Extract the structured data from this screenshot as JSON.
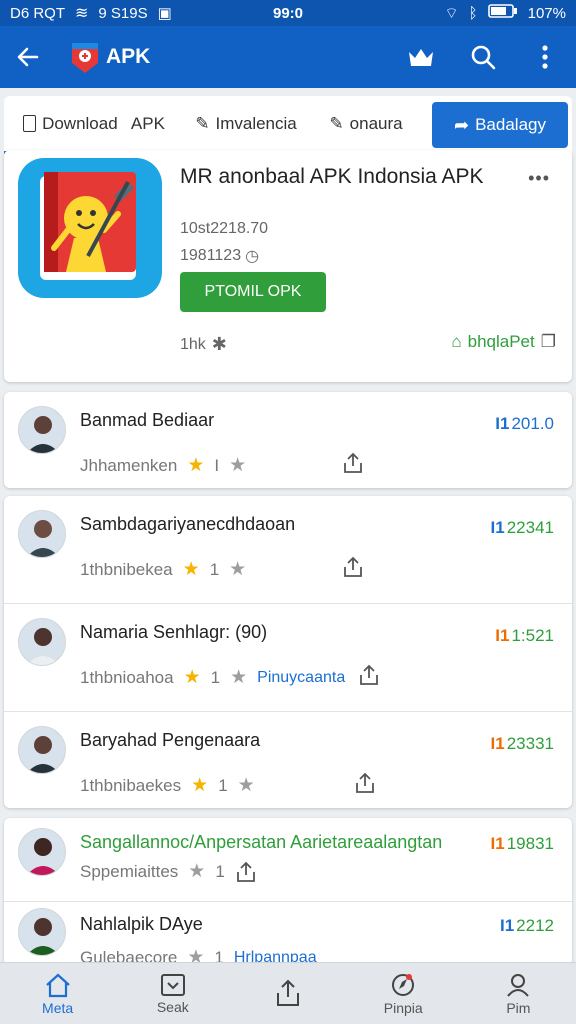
{
  "status": {
    "left": "D6 RQT",
    "wifi": "ᯤ",
    "extra": "9 S19S",
    "time": "99:0",
    "battery": "107%"
  },
  "appbar": {
    "title": "APK"
  },
  "tabs": [
    {
      "label": "Download   APK"
    },
    {
      "label": "Imvalencia"
    },
    {
      "label": "onaura"
    },
    {
      "label": "Badalagy"
    }
  ],
  "app": {
    "title": "MR anonbaal APK Indonsia APK",
    "meta1": "10st2218.70",
    "meta2": "1981123",
    "install_label": "PTOMIL OPK",
    "more": "•••",
    "size": "1hk",
    "publisher": "bhqlaPet"
  },
  "reviews_group1": [
    {
      "name": "Banmad Bediaar",
      "sub": "Jhhamenken",
      "score_prefix": "I1",
      "score": "201.0",
      "score_color": "#1c6fd1"
    }
  ],
  "reviews_group2": [
    {
      "name": "Sambdagariyanecdhdaoan",
      "sub": "1thbnibekea",
      "score_prefix": "I1",
      "score": "22341",
      "score_color": "#2f9e3b"
    },
    {
      "name": "Namaria Senhlagr: (90)",
      "sub": "1thbnioahoa",
      "extra": "Pinuycaanta",
      "score_prefix": "I1",
      "score": "1:521",
      "score_color": "#2f9e3b"
    },
    {
      "name": "Baryahad Pengenaara",
      "sub": "1thbnibaekes",
      "score_prefix": "I1",
      "score": "23331",
      "score_color": "#2f9e3b"
    }
  ],
  "reviews_group3": [
    {
      "name": "Sangallannoc/Anpersatan Aarietareaalangtan",
      "sub": "Sppemiaittes",
      "score_prefix": "I1",
      "score": "19831",
      "score_color": "#2f9e3b"
    },
    {
      "name": "Nahlalpik DAye",
      "sub": "Gulebaecore",
      "extra": "Hrlpannpaa",
      "score_prefix": "I1",
      "score": "2212",
      "score_color": "#2f9e3b"
    }
  ],
  "bottom_nav": [
    {
      "label": "Meta",
      "icon": "home-icon"
    },
    {
      "label": "Seak",
      "icon": "inbox-icon"
    },
    {
      "label": "",
      "icon": "share-icon"
    },
    {
      "label": "Pinpia",
      "icon": "compass-icon"
    },
    {
      "label": "Pim",
      "icon": "person-icon"
    }
  ],
  "colors": {
    "primary": "#1160c4",
    "accent": "#1c6fd1",
    "green": "#2f9e3b",
    "star": "#f4b400"
  }
}
